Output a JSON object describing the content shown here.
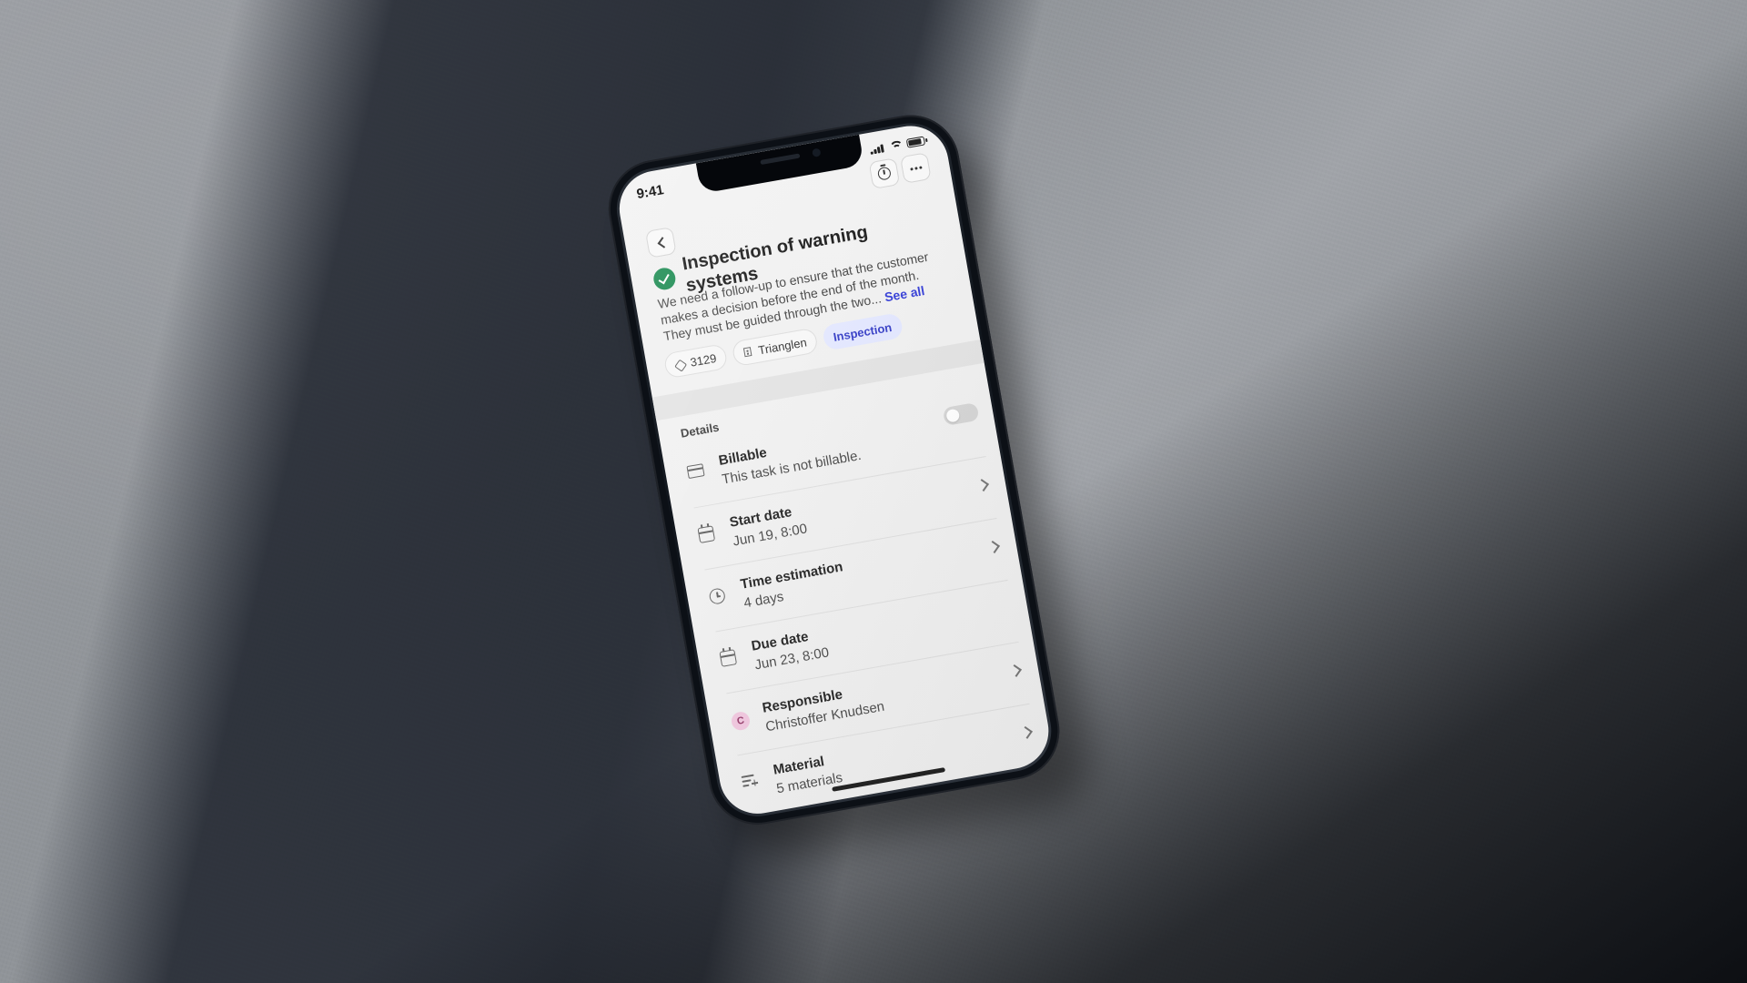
{
  "status_bar": {
    "time": "9:41"
  },
  "task": {
    "title": "Inspection of warning systems",
    "description_line_1": "We need a follow-up to ensure that the customer",
    "description_line_2": "makes a decision before the end of the month.",
    "description_line_3": "They must be guided through the two...",
    "see_all": "See all"
  },
  "tags": [
    {
      "label": "3129",
      "icon": "price-tag-icon"
    },
    {
      "label": "Trianglen",
      "icon": "building-icon"
    },
    {
      "label": "Inspection",
      "icon": "",
      "accent": "#e4e8ff"
    }
  ],
  "details": {
    "section_label": "Details",
    "items": [
      {
        "title": "Billable",
        "value": "This task is not billable.",
        "icon": "credit-card-icon",
        "toggle": "off"
      },
      {
        "title": "Start date",
        "value": "Jun 19, 8:00",
        "icon": "calendar-icon"
      },
      {
        "title": "Time estimation",
        "value": "4 days",
        "icon": "clock-icon"
      },
      {
        "title": "Due date",
        "value": "Jun 23, 8:00",
        "icon": "calendar-icon"
      },
      {
        "title": "Responsible",
        "value": "Christoffer Knudsen",
        "icon": "avatar-icon",
        "avatar_initial": "C"
      },
      {
        "title": "Material",
        "value": "5 materials",
        "icon": "material-list-icon"
      }
    ]
  },
  "colors": {
    "success": "#208d55",
    "link": "#3a43d8",
    "accent_tag_bg": "#e4e8ff",
    "accent_tag_text": "#3b43c8",
    "avatar_bg": "#f1c8df",
    "avatar_text": "#973f6d"
  }
}
